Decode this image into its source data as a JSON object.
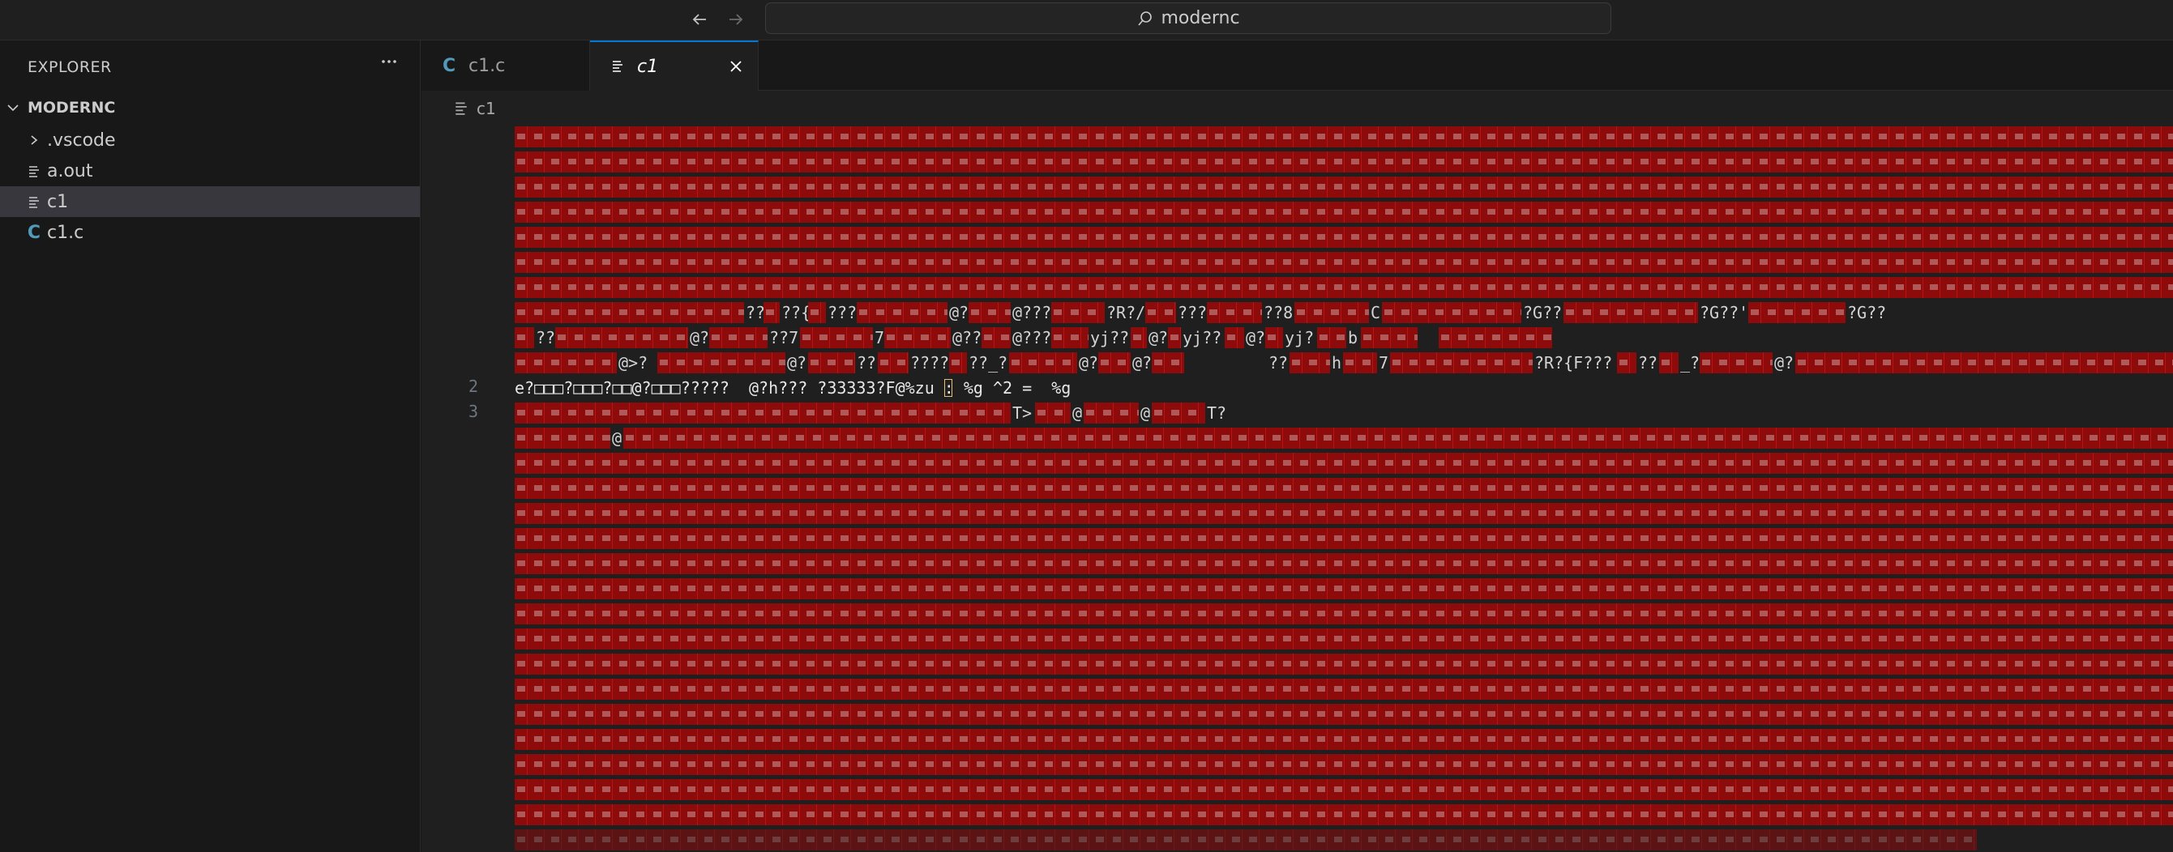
{
  "titlebar": {
    "back_icon": "arrow-left-icon",
    "forward_icon": "arrow-right-icon",
    "search_text": "modernc"
  },
  "sidebar": {
    "title": "EXPLORER",
    "more_icon": "ellipsis-icon",
    "folder": "MODERNC",
    "items": [
      {
        "label": ".vscode",
        "icon": "chevron-right-icon"
      },
      {
        "label": "a.out",
        "icon": "lines-file-icon"
      },
      {
        "label": "c1",
        "icon": "lines-file-icon",
        "selected": true
      },
      {
        "label": "c1.c",
        "icon": "c-file-icon"
      }
    ]
  },
  "tabs": [
    {
      "label": "c1.c",
      "active": false
    },
    {
      "label": "c1",
      "active": true
    }
  ],
  "breadcrumb": {
    "label": "c1"
  },
  "editor": {
    "line_numbers": [
      "2",
      "3"
    ],
    "text_line_2": "\u0000?\u0000?\u0000?\u0000\u0000\u0000?\u0000\u0000?????  @?h??? ?33333?F@%zu : %g ^2 =  %g",
    "text_line_2_visible": "e?□□□?□□□?□□@?□□□?????  @?h??? ?33333?F@%zu : %g ^2 =  %g",
    "text_line_3_a": "T>",
    "text_line_3_b": "@",
    "text_line_3_c": "@",
    "text_line_3_d": "T?",
    "line_e_text_a": "??",
    "line_e_text_b": "??{",
    "line_e_text_c": "???",
    "line_e_text_d": "@?",
    "line_e_text_e": "@???",
    "line_e_text_f": "?R?/",
    "line_e_text_g": "???",
    "line_e_text_h": "??8",
    "line_e_text_i": "C",
    "line_e_text_j": "?G??",
    "line_e_text_k": "?G??'",
    "line_e_text_l": "?G??",
    "line_f_text_a": "??",
    "line_f_text_b": "@?",
    "line_f_text_c": "??7",
    "line_f_text_d": "7",
    "line_f_text_e": "@??",
    "line_f_text_f": "@???",
    "line_f_text_g": "yj??",
    "line_f_text_h": "@?",
    "line_f_text_i": "yj??",
    "line_f_text_j": "@?",
    "line_f_text_k": "yj?",
    "line_f_text_l": "b",
    "line_g_text_a": "@>?",
    "line_g_text_b": "@?",
    "line_g_text_c": "??",
    "line_g_text_d": "????",
    "line_g_text_e": "??_?",
    "line_g_text_f": "@?",
    "line_g_text_g": "@?",
    "line_g_text_h": "??",
    "line_g_text_i": "h",
    "line_g_text_j": "7",
    "line_g_text_k": "?R?{F???",
    "line_g_text_l": "??",
    "line_g_text_m": "_?",
    "line_g_text_n": "@?",
    "line_h_text_a": "@"
  }
}
